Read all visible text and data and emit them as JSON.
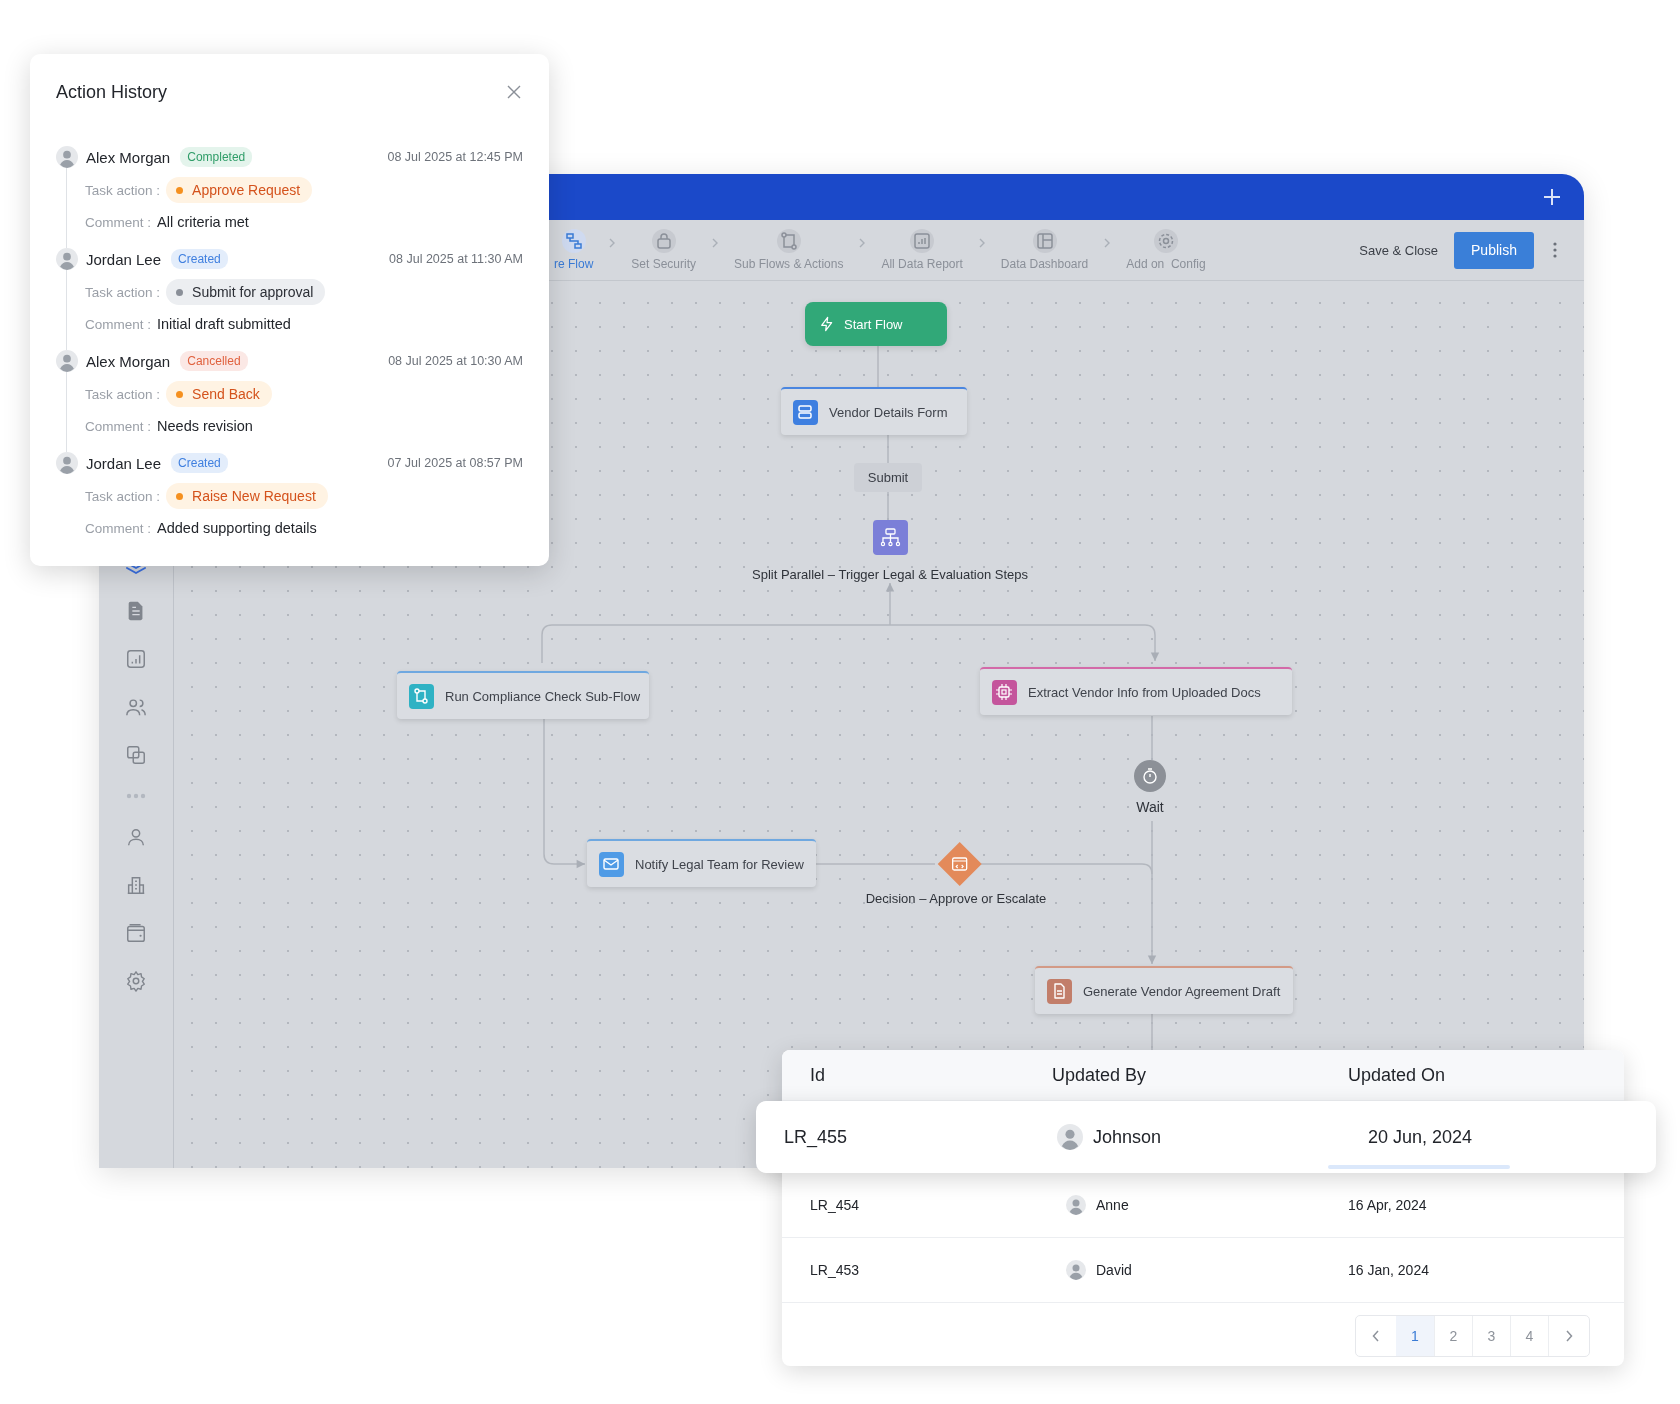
{
  "action_history": {
    "title": "Action History",
    "entries": [
      {
        "user": "Alex Morgan",
        "status": {
          "label": "Completed",
          "kind": "completed"
        },
        "timestamp": "08 Jul 2025 at 12:45 PM",
        "task_label": "Task action :",
        "action": {
          "label": "Approve Request",
          "kind": "warning"
        },
        "comment_label": "Comment :",
        "comment": "All criteria met"
      },
      {
        "user": "Jordan Lee",
        "status": {
          "label": "Created",
          "kind": "created"
        },
        "timestamp": "08 Jul 2025 at 11:30 AM",
        "task_label": "Task action :",
        "action": {
          "label": "Submit for approval",
          "kind": "neutral"
        },
        "comment_label": "Comment :",
        "comment": "Initial draft submitted"
      },
      {
        "user": "Alex Morgan",
        "status": {
          "label": "Cancelled",
          "kind": "cancelled"
        },
        "timestamp": "08 Jul 2025 at 10:30 AM",
        "task_label": "Task action :",
        "action": {
          "label": "Send Back",
          "kind": "warning"
        },
        "comment_label": "Comment :",
        "comment": "Needs revision"
      },
      {
        "user": "Jordan Lee",
        "status": {
          "label": "Created",
          "kind": "created"
        },
        "timestamp": "07 Jul 2025 at 08:57 PM",
        "task_label": "Task action :",
        "action": {
          "label": "Raise New Request",
          "kind": "warning"
        },
        "comment_label": "Comment :",
        "comment": "Added supporting details"
      }
    ]
  },
  "sidebar": {
    "items": [
      {
        "selected": true
      },
      {
        "selected": false
      },
      {
        "selected": false
      },
      {
        "selected": false
      },
      {
        "selected": false
      },
      {
        "selected": false
      },
      {
        "selected": false
      },
      {
        "selected": false
      },
      {
        "selected": false
      }
    ]
  },
  "toolbar": {
    "steps": [
      {
        "label": "re Flow",
        "selected": true
      },
      {
        "label": "Set Security",
        "selected": false
      },
      {
        "label": "Sub Flows & Actions",
        "selected": false
      },
      {
        "label": "All Data Report",
        "selected": false
      },
      {
        "label": "Data Dashboard",
        "selected": false
      },
      {
        "label": "Add on  Config",
        "selected": false
      }
    ],
    "save_label": "Save & Close",
    "publish_label": "Publish"
  },
  "flow": {
    "nodes": [
      {
        "kind": "start",
        "label": "Start Flow"
      },
      {
        "kind": "form",
        "label": "Vendor Details Form"
      },
      {
        "kind": "tag",
        "label": "Submit"
      },
      {
        "kind": "split",
        "label": "Split Parallel – Trigger Legal & Evaluation Steps"
      },
      {
        "kind": "subflow",
        "label": "Run Compliance Check Sub-Flow"
      },
      {
        "kind": "extract",
        "label": "Extract Vendor Info from Uploaded Docs"
      },
      {
        "kind": "wait",
        "label": "Wait"
      },
      {
        "kind": "notify",
        "label": "Notify Legal Team for Review"
      },
      {
        "kind": "decision",
        "label": "Decision – Approve or Escalate"
      },
      {
        "kind": "document",
        "label": "Generate Vendor Agreement Draft"
      }
    ]
  },
  "table": {
    "columns": [
      "Id",
      "Updated By",
      "Updated On"
    ],
    "rows": [
      {
        "id": "LR_455",
        "updated_by": "Johnson",
        "updated_on": "20 Jun, 2024",
        "selected": true
      },
      {
        "id": "LR_454",
        "updated_by": "Anne",
        "updated_on": "16 Apr, 2024",
        "selected": false
      },
      {
        "id": "LR_453",
        "updated_by": "David",
        "updated_on": "16 Jan, 2024",
        "selected": false
      }
    ],
    "pagination": {
      "pages": [
        {
          "label": "1",
          "selected": true
        },
        {
          "label": "2",
          "selected": false
        },
        {
          "label": "3",
          "selected": false
        },
        {
          "label": "4",
          "selected": false
        }
      ]
    }
  }
}
